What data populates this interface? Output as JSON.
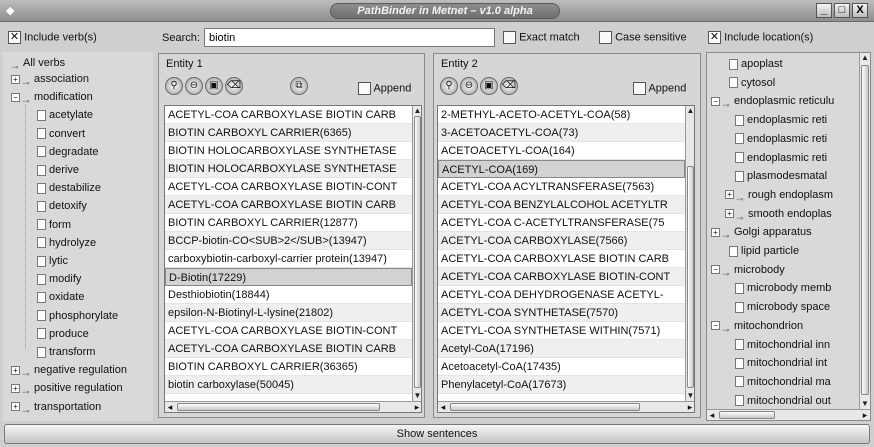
{
  "window": {
    "title": "PathBinder in Metnet – v1.0 alpha",
    "minimize": "_",
    "maximize": "□",
    "close": "X"
  },
  "topbar": {
    "include_verbs_label": "Include verb(s)",
    "search_label": "Search:",
    "search_value": "biotin",
    "exact_match_label": "Exact match",
    "case_sensitive_label": "Case sensitive",
    "include_location_label": "Include location(s)"
  },
  "verbs": {
    "root": "All verbs",
    "items": [
      {
        "label": "association",
        "expander": "+"
      },
      {
        "label": "modification",
        "expander": "−"
      },
      {
        "label": "acetylate"
      },
      {
        "label": "convert"
      },
      {
        "label": "degradate"
      },
      {
        "label": "derive"
      },
      {
        "label": "destabilize"
      },
      {
        "label": "detoxify"
      },
      {
        "label": "form"
      },
      {
        "label": "hydrolyze"
      },
      {
        "label": "lytic"
      },
      {
        "label": "modify"
      },
      {
        "label": "oxidate"
      },
      {
        "label": "phosphorylate"
      },
      {
        "label": "produce"
      },
      {
        "label": "transform"
      },
      {
        "label": "negative regulation",
        "expander": "+"
      },
      {
        "label": "positive regulation",
        "expander": "+"
      },
      {
        "label": "transportation",
        "expander": "+"
      }
    ]
  },
  "entity1": {
    "label": "Entity 1",
    "append_label": "Append",
    "rows": [
      "ACETYL-COA CARBOXYLASE BIOTIN CARB",
      "BIOTIN CARBOXYL CARRIER(6365)",
      "BIOTIN HOLOCARBOXYLASE SYNTHETASE",
      "BIOTIN HOLOCARBOXYLASE SYNTHETASE",
      "ACETYL-COA CARBOXYLASE BIOTIN-CONT",
      "ACETYL-COA CARBOXYLASE BIOTIN CARB",
      "BIOTIN CARBOXYL CARRIER(12877)",
      "BCCP-biotin-CO<SUB>2</SUB>(13947)",
      "carboxybiotin-carboxyl-carrier protein(13947)",
      "D-Biotin(17229)",
      "Desthiobiotin(18844)",
      "epsilon-N-Biotinyl-L-lysine(21802)",
      "ACETYL-COA CARBOXYLASE BIOTIN-CONT",
      "ACETYL-COA CARBOXYLASE BIOTIN CARB",
      "BIOTIN CARBOXYL CARRIER(36365)",
      "biotin carboxylase(50045)"
    ],
    "selected_index": 9
  },
  "entity2": {
    "label": "Entity 2",
    "append_label": "Append",
    "rows": [
      "2-METHYL-ACETO-ACETYL-COA(58)",
      "3-ACETOACETYL-COA(73)",
      "ACETOACETYL-COA(164)",
      "ACETYL-COA(169)",
      "ACETYL-COA ACYLTRANSFERASE(7563)",
      "ACETYL-COA BENZYLALCOHOL ACETYLTR",
      "ACETYL-COA C-ACETYLTRANSFERASE(75",
      "ACETYL-COA CARBOXYLASE(7566)",
      "ACETYL-COA CARBOXYLASE BIOTIN CARB",
      "ACETYL-COA CARBOXYLASE BIOTIN-CONT",
      "ACETYL-COA DEHYDROGENASE ACETYL-",
      "ACETYL-COA SYNTHETASE(7570)",
      "ACETYL-COA SYNTHETASE WITHIN(7571)",
      "Acetyl-CoA(17196)",
      "Acetoacetyl-CoA(17435)",
      "Phenylacetyl-CoA(17673)"
    ],
    "selected_index": 3
  },
  "locations": {
    "items": [
      {
        "label": "apoplast",
        "level": 1
      },
      {
        "label": "cytosol",
        "level": 1
      },
      {
        "label": "endoplasmic reticulu",
        "level": 0,
        "expander": "−"
      },
      {
        "label": "endoplasmic reti",
        "level": 2
      },
      {
        "label": "endoplasmic reti",
        "level": 2
      },
      {
        "label": "endoplasmic reti",
        "level": 2
      },
      {
        "label": "plasmodesmatal",
        "level": 2
      },
      {
        "label": "rough endoplasm",
        "level": 1,
        "expander": "+"
      },
      {
        "label": "smooth endoplas",
        "level": 1,
        "expander": "+"
      },
      {
        "label": "Golgi apparatus",
        "level": 0,
        "expander": "+"
      },
      {
        "label": "lipid particle",
        "level": 1
      },
      {
        "label": "microbody",
        "level": 0,
        "expander": "−"
      },
      {
        "label": "microbody memb",
        "level": 2
      },
      {
        "label": "microbody space",
        "level": 2
      },
      {
        "label": "mitochondrion",
        "level": 0,
        "expander": "−"
      },
      {
        "label": "mitochondrial inn",
        "level": 2
      },
      {
        "label": "mitochondrial int",
        "level": 2
      },
      {
        "label": "mitochondrial ma",
        "level": 2
      },
      {
        "label": "mitochondrial out",
        "level": 2
      }
    ]
  },
  "bottom": {
    "show_sentences_label": "Show sentences"
  }
}
